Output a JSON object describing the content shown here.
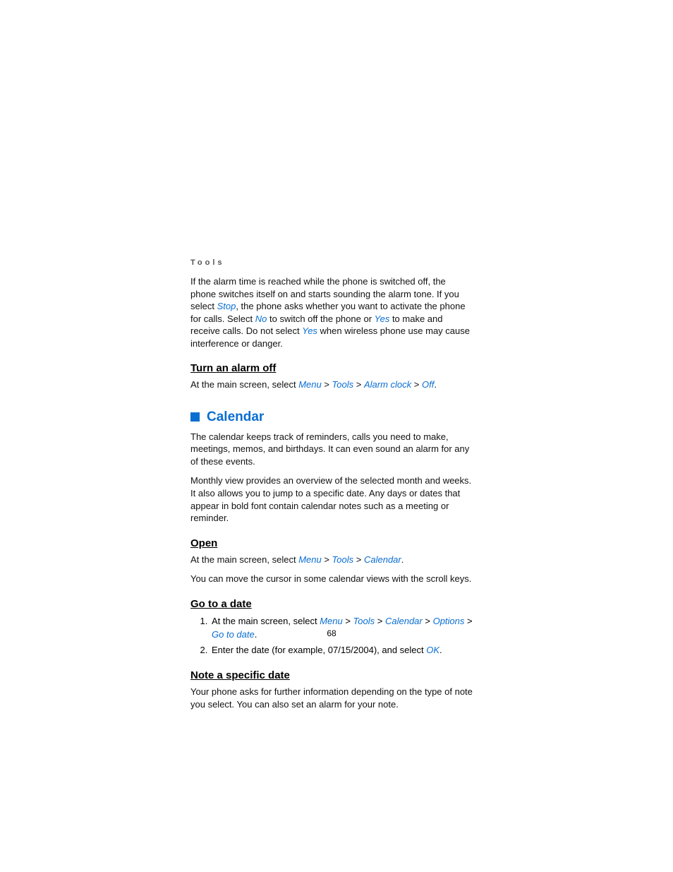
{
  "kicker": "Tools",
  "intro": {
    "t1": "If the alarm time is reached while the phone is switched off, the phone switches itself on and starts sounding the alarm tone. If you select ",
    "stop": "Stop",
    "t2": ", the phone asks whether you want to activate the phone for calls. Select ",
    "no": "No",
    "t3": " to switch off the phone or ",
    "yes": "Yes",
    "t4": " to make and receive calls. Do not select ",
    "yes2": "Yes",
    "t5": " when wireless phone use may cause interference or danger."
  },
  "turn_off": {
    "heading": "Turn an alarm off",
    "lead": "At the main screen, select ",
    "menu": "Menu",
    "sep": " > ",
    "tools": "Tools",
    "alarm": "Alarm clock",
    "off": "Off",
    "end": "."
  },
  "calendar": {
    "heading": "Calendar",
    "p1": "The calendar keeps track of reminders, calls you need to make, meetings, memos, and birthdays. It can even sound an alarm for any of these events.",
    "p2": "Monthly view provides an overview of the selected month and weeks. It also allows you to jump to a specific date. Any days or dates that appear in bold font contain calendar notes such as a meeting or reminder."
  },
  "open": {
    "heading": "Open",
    "lead": "At the main screen, select ",
    "menu": "Menu",
    "sep": " > ",
    "tools": "Tools",
    "calendar": "Calendar",
    "end": ".",
    "p2": "You can move the cursor in some calendar views with the scroll keys."
  },
  "goto": {
    "heading": "Go to a date",
    "li1_lead": "At the main screen, select ",
    "menu": "Menu",
    "sep": " > ",
    "tools": "Tools",
    "calendar": "Calendar",
    "options": "Options",
    "gotodate": "Go to date",
    "end": ".",
    "li2_a": "Enter the date (for example, 07/15/2004), and select ",
    "ok": "OK",
    "li2_end": "."
  },
  "note": {
    "heading": "Note a specific date",
    "p1": "Your phone asks for further information depending on the type of note you select. You can also set an alarm for your note."
  },
  "page_number": "68"
}
